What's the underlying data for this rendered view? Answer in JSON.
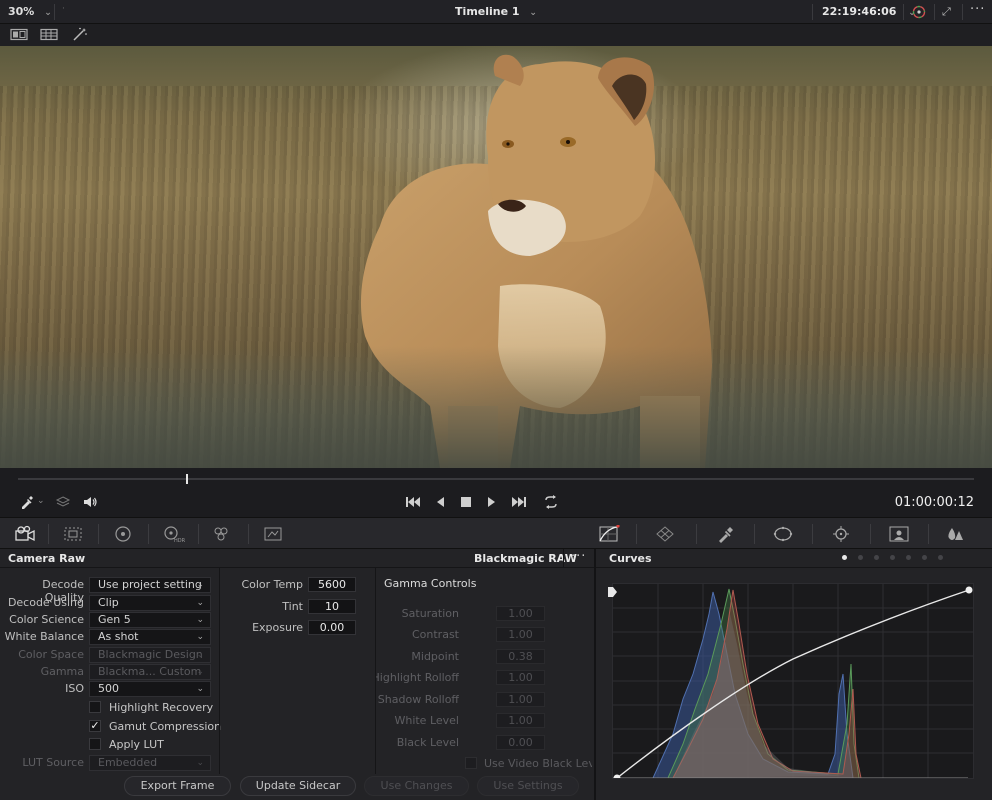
{
  "topbar": {
    "zoom": "30%",
    "timeline_title": "Timeline 1",
    "timecode": "22:19:46:06"
  },
  "transport": {
    "timecode": "01:00:00:12"
  },
  "camera_raw": {
    "title": "Camera Raw",
    "raw_format": "Blackmagic RAW",
    "fields": [
      {
        "label": "Decode Quality",
        "value": "Use project setting",
        "enabled": true
      },
      {
        "label": "Decode Using",
        "value": "Clip",
        "enabled": true
      },
      {
        "label": "Color Science",
        "value": "Gen 5",
        "enabled": true
      },
      {
        "label": "White Balance",
        "value": "As shot",
        "enabled": true
      },
      {
        "label": "Color Space",
        "value": "Blackmagic Design",
        "enabled": false
      },
      {
        "label": "Gamma",
        "value": "Blackma... Custom",
        "enabled": false
      },
      {
        "label": "ISO",
        "value": "500",
        "enabled": true
      }
    ],
    "checkboxes": [
      {
        "label": "Highlight Recovery",
        "checked": false
      },
      {
        "label": "Gamut Compression",
        "checked": true
      },
      {
        "label": "Apply LUT",
        "checked": false
      }
    ],
    "lut_source": {
      "label": "LUT Source",
      "value": "Embedded"
    },
    "adjust": [
      {
        "label": "Color Temp",
        "value": "5600"
      },
      {
        "label": "Tint",
        "value": "10"
      },
      {
        "label": "Exposure",
        "value": "0.00"
      }
    ],
    "gamma_controls": {
      "title": "Gamma Controls",
      "rows": [
        {
          "label": "Saturation",
          "value": "1.00"
        },
        {
          "label": "Contrast",
          "value": "1.00"
        },
        {
          "label": "Midpoint",
          "value": "0.38"
        },
        {
          "label": "Highlight Rolloff",
          "value": "1.00"
        },
        {
          "label": "Shadow Rolloff",
          "value": "1.00"
        },
        {
          "label": "White Level",
          "value": "1.00"
        },
        {
          "label": "Black Level",
          "value": "0.00"
        }
      ],
      "use_video_black": "Use Video Black Level"
    },
    "buttons": {
      "export_frame": "Export Frame",
      "update_sidecar": "Update Sidecar",
      "use_changes": "Use Changes",
      "use_settings": "Use Settings"
    }
  },
  "curves": {
    "title": "Curves",
    "page_dots": 7,
    "active_dot": 0
  },
  "colors": {
    "accent_red": "#e0403a",
    "histogram_blue": "#3a5a9a",
    "histogram_red": "#a84a46",
    "histogram_green": "#4a8a4a"
  }
}
